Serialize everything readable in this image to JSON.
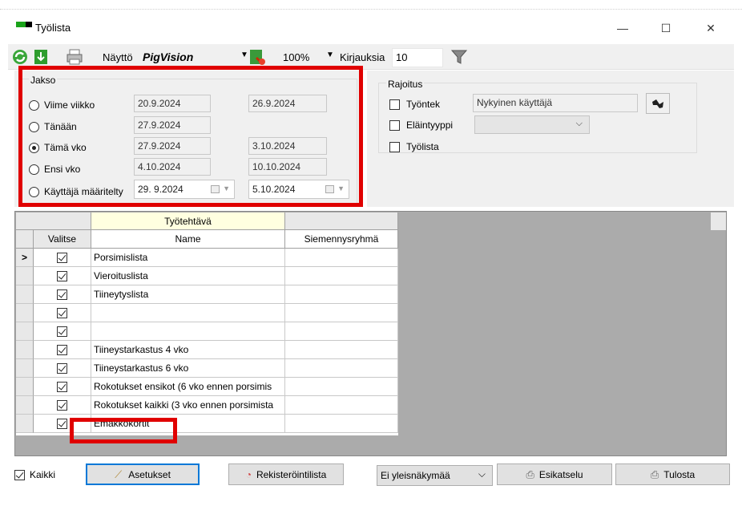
{
  "window": {
    "title": "Työlista",
    "minimize_glyph": "—",
    "maximize_glyph": "☐",
    "close_glyph": "✕"
  },
  "toolbar": {
    "refresh_icon": "refresh-icon",
    "download_icon": "download-icon",
    "print_icon": "printer-icon",
    "display_label": "Näyttö",
    "display_value": "PigVision",
    "display_arrow": "▼",
    "export_icon": "export-icon",
    "zoom_value": "100%",
    "zoom_arrow": "▼",
    "records_label": "Kirjauksia",
    "records_value": "10",
    "filter_icon": "filter-icon"
  },
  "jakso": {
    "title": "Jakso",
    "options": [
      {
        "label": "Viime viikko",
        "from": "20.9.2024",
        "to": "26.9.2024",
        "selected": false
      },
      {
        "label": "Tänään",
        "from": "27.9.2024",
        "to": "",
        "selected": false
      },
      {
        "label": "Tämä vko",
        "from": "27.9.2024",
        "to": "3.10.2024",
        "selected": true
      },
      {
        "label": "Ensi vko",
        "from": "4.10.2024",
        "to": "10.10.2024",
        "selected": false
      },
      {
        "label": "Käyttäjä määritelty",
        "from": "29.  9.2024",
        "to": "5.10.2024",
        "selected": false
      }
    ]
  },
  "rajoitus": {
    "title": "Rajoitus",
    "employee_label": "Työntek",
    "employee_value": "Nykyinen käyttäjä",
    "animal_type_label": "Eläintyyppi",
    "animal_type_value": "",
    "worklist_label": "Työlista",
    "lookup_icon": "binoculars-icon"
  },
  "grid": {
    "group_header": "Työtehtävä",
    "columns": [
      "Valitse",
      "Name",
      "Siemennysryhmä"
    ],
    "current_row_marker": ">",
    "rows": [
      {
        "checked": true,
        "name": "Porsimislista",
        "group": ""
      },
      {
        "checked": true,
        "name": "Vieroituslista",
        "group": ""
      },
      {
        "checked": true,
        "name": "Tiineytyslista",
        "group": ""
      },
      {
        "checked": true,
        "name": "",
        "group": ""
      },
      {
        "checked": true,
        "name": "",
        "group": ""
      },
      {
        "checked": true,
        "name": "Tiineystarkastus 4 vko",
        "group": ""
      },
      {
        "checked": true,
        "name": "Tiineystarkastus 6 vko",
        "group": ""
      },
      {
        "checked": true,
        "name": "Rokotukset ensikot (6 vko ennen porsimis",
        "group": ""
      },
      {
        "checked": true,
        "name": "Rokotukset kaikki (3 vko ennen porsimista",
        "group": ""
      },
      {
        "checked": true,
        "name": "Emakkokortit",
        "group": ""
      }
    ]
  },
  "bottom": {
    "all_label": "Kaikki",
    "settings_label": "Asetukset",
    "registry_label": "Rekisteröintilista",
    "view_value": "Ei yleisnäkymää",
    "preview_label": "Esikatselu",
    "print_label": "Tulosta"
  },
  "colors": {
    "highlight": "#e00000",
    "panel_bg": "#f0f0f0",
    "accent_focus": "#0078d7"
  }
}
